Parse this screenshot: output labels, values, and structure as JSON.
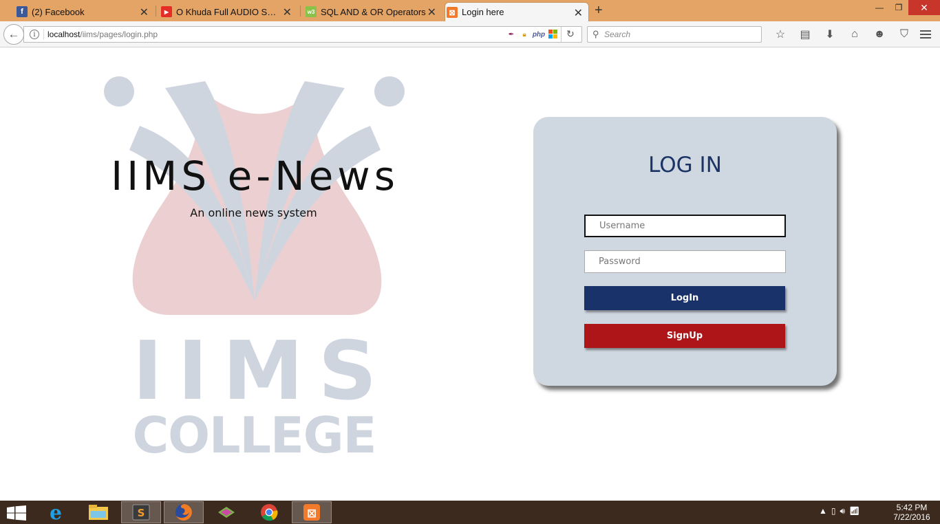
{
  "browser": {
    "tabs": [
      {
        "label": "(2) Facebook",
        "icon": "facebook-icon",
        "color": "#3b5998",
        "glyph": "f"
      },
      {
        "label": "O Khuda Full AUDIO Song...",
        "icon": "youtube-icon",
        "color": "#e52d27",
        "glyph": "▶"
      },
      {
        "label": "SQL AND & OR Operators",
        "icon": "w3schools-icon",
        "color": "#8ac249",
        "glyph": "w3"
      },
      {
        "label": "Login here",
        "icon": "xampp-icon",
        "color": "#f37a2a",
        "glyph": "⊠",
        "active": true
      }
    ],
    "url_host": "localhost",
    "url_path": "/iims/pages/login.php",
    "search_placeholder": "Search"
  },
  "page": {
    "site_title": "IIMS e-News",
    "site_subtitle": "An online news system",
    "logo_text_top": "IIMS",
    "logo_text_bottom": "COLLEGE",
    "login": {
      "title": "LOG IN",
      "username_placeholder": "Username",
      "password_placeholder": "Password",
      "login_label": "LogIn",
      "signup_label": "SignUp"
    }
  },
  "taskbar": {
    "time": "5:42 PM",
    "date": "7/22/2016"
  },
  "colors": {
    "navy": "#19336a",
    "red": "#ad1518",
    "card": "#cfd7e0"
  }
}
